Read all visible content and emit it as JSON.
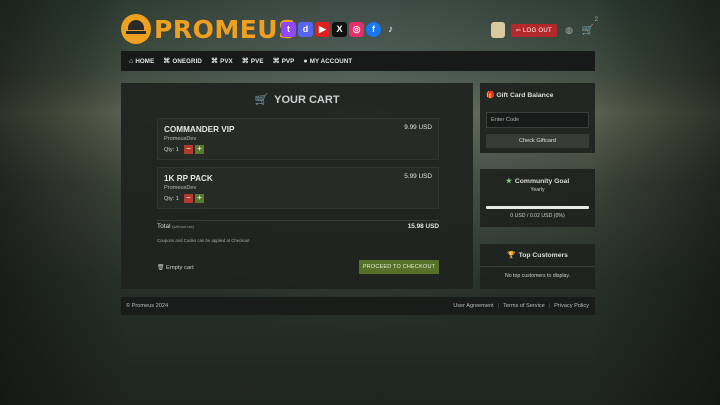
{
  "brand": {
    "name": "PROMEUS"
  },
  "socials": [
    {
      "icon": "twitch-icon",
      "glyph": "t"
    },
    {
      "icon": "discord-icon",
      "glyph": "d"
    },
    {
      "icon": "youtube-icon",
      "glyph": "▶"
    },
    {
      "icon": "x-icon",
      "glyph": "X"
    },
    {
      "icon": "instagram-icon",
      "glyph": "◎"
    },
    {
      "icon": "facebook-icon",
      "glyph": "f"
    },
    {
      "icon": "tiktok-icon",
      "glyph": "♪"
    }
  ],
  "header": {
    "logout_label": "LOG OUT",
    "cart_count": "2"
  },
  "nav": [
    {
      "label": "HOME",
      "icon": "⌂"
    },
    {
      "label": "ONEGRID",
      "icon": "⌘"
    },
    {
      "label": "PVX",
      "icon": "⌘"
    },
    {
      "label": "PVE",
      "icon": "⌘"
    },
    {
      "label": "PVP",
      "icon": "⌘"
    },
    {
      "label": "MY ACCOUNT",
      "icon": "●"
    }
  ],
  "cart": {
    "title": "YOUR CART",
    "items": [
      {
        "name": "COMMANDER VIP",
        "owner": "PromeusDev",
        "qty_label": "Qty: 1",
        "price": "9.99 USD"
      },
      {
        "name": "1K RP PACK",
        "owner": "PromeusDev",
        "qty_label": "Qty: 1",
        "price": "5.99 USD"
      }
    ],
    "total_label": "Total",
    "total_note": "(without tax)",
    "total_value": "15.98 USD",
    "coupon_note": "Coupons and Codes can be applied at Checkout",
    "empty_label": "Empty cart",
    "checkout_label": "PROCEED TO CHECKOUT"
  },
  "giftcard": {
    "title": "Gift Card Balance",
    "placeholder": "Enter Code",
    "button": "Check Giftcard"
  },
  "goal": {
    "title": "Community Goal",
    "period": "Yearly",
    "progress_percent": 0,
    "amount_text": "0 USD / 0.02 USD (0%)"
  },
  "top_customers": {
    "title": "Top Customers",
    "message": "No top customers to display."
  },
  "footer": {
    "copyright": "© Promeus 2024",
    "links": [
      "User Agreement",
      "Terms of Service",
      "Privacy Policy"
    ]
  },
  "colors": {
    "accent": "#f0a020",
    "logout": "#b2282b",
    "checkout": "#56702a",
    "success": "#7fd07f"
  }
}
